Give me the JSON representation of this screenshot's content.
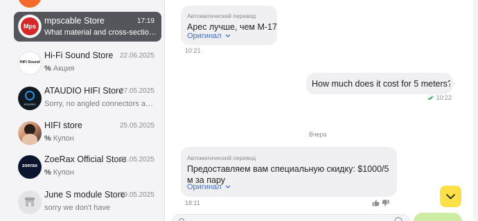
{
  "colors": {
    "active_item": "#55565b",
    "bubble": "#f0f0f3",
    "link": "#3b6ed8",
    "scroll_button": "#fde047",
    "send_button": "#cdeca3"
  },
  "sidebar": {
    "items": [
      {
        "name": "",
        "date": "",
        "preview": "",
        "avatar_text": "",
        "icon": ""
      },
      {
        "name": "mpscable Store",
        "date": "17:19",
        "preview": "What material and cross-section ...",
        "avatar_text": "Mps",
        "icon": "mps-logo"
      },
      {
        "name": "Hi-Fi Sound Store",
        "date": "22.06.2025",
        "preview_icon": "%",
        "preview": "Акция",
        "avatar_text": "HiFi Sound",
        "icon": "hifi-sound-logo"
      },
      {
        "name": "ATAUDIO HIFI Store",
        "date": "27.05.2025",
        "preview": "Sorry, no angled connectors avai...",
        "avatar_text": "ATAUDIO",
        "icon": "ataudio-logo"
      },
      {
        "name": "HIFI store",
        "date": "25.05.2025",
        "preview_icon": "%",
        "preview": "Купон",
        "icon": "hifi-store-avatar"
      },
      {
        "name": "ZoeRax Official Store",
        "date": "21.05.2025",
        "preview_icon": "%",
        "preview": "Купон",
        "avatar_text": "zoerax",
        "icon": "zoerax-logo"
      },
      {
        "name": "June S module Store",
        "date": "19.05.2025",
        "preview": "sorry we don't have",
        "icon": "store-icon"
      }
    ]
  },
  "chat": {
    "messages": [
      {
        "auto_label": "Автоматический перевод",
        "text": "Арес лучше, чем М-17",
        "original_link": "Оригинал",
        "time": "10:21"
      },
      {
        "text": "How much does it cost for 5 meters?",
        "time": "10:22",
        "status_icon": "double-check-icon"
      },
      {
        "auto_label": "Автоматический перевод",
        "text": "Предоставляем вам специальную скидку: $1000/5 м за пару",
        "original_link": "Оригинал",
        "time": "18:11"
      }
    ],
    "date_separator": "Вчера",
    "icons": [
      "chevron-down-icon",
      "thumbs-up-icon",
      "thumbs-down-icon",
      "attach-icon",
      "emoji-icon"
    ]
  }
}
